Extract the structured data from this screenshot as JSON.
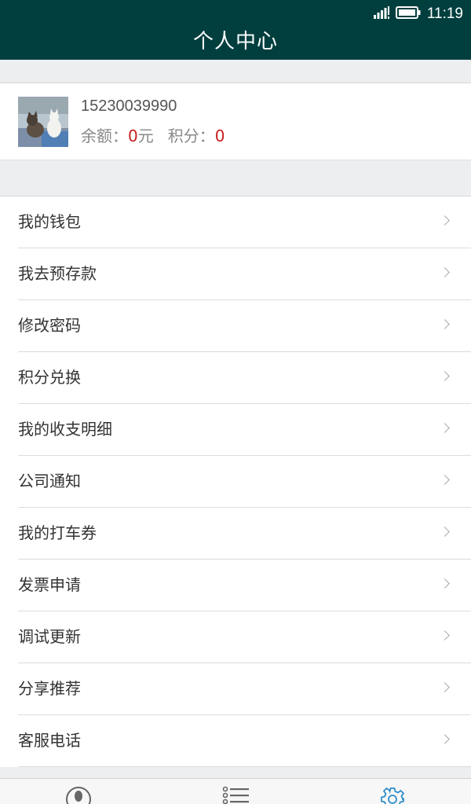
{
  "status_bar": {
    "time": "11:19",
    "icons": [
      "signal-icon",
      "battery-icon"
    ]
  },
  "header": {
    "title": "个人中心"
  },
  "profile": {
    "phone": "15230039990",
    "balance_label": "余额：",
    "balance_value": "0",
    "balance_unit": "元",
    "points_label": "积分：",
    "points_value": "0"
  },
  "menu": {
    "items": [
      {
        "label": "我的钱包"
      },
      {
        "label": "我去预存款"
      },
      {
        "label": "修改密码"
      },
      {
        "label": "积分兑换"
      },
      {
        "label": "我的收支明细"
      },
      {
        "label": "公司通知"
      },
      {
        "label": "我的打车券"
      },
      {
        "label": "发票申请"
      },
      {
        "label": "调试更新"
      },
      {
        "label": "分享推荐"
      },
      {
        "label": "客服电话"
      }
    ]
  },
  "tab_bar": {
    "icons": [
      "user-icon",
      "list-icon",
      "gear-icon"
    ]
  },
  "colors": {
    "header_bg": "#003f3e",
    "accent_red": "#c81e1e",
    "active_tab": "#2d8ec9"
  }
}
